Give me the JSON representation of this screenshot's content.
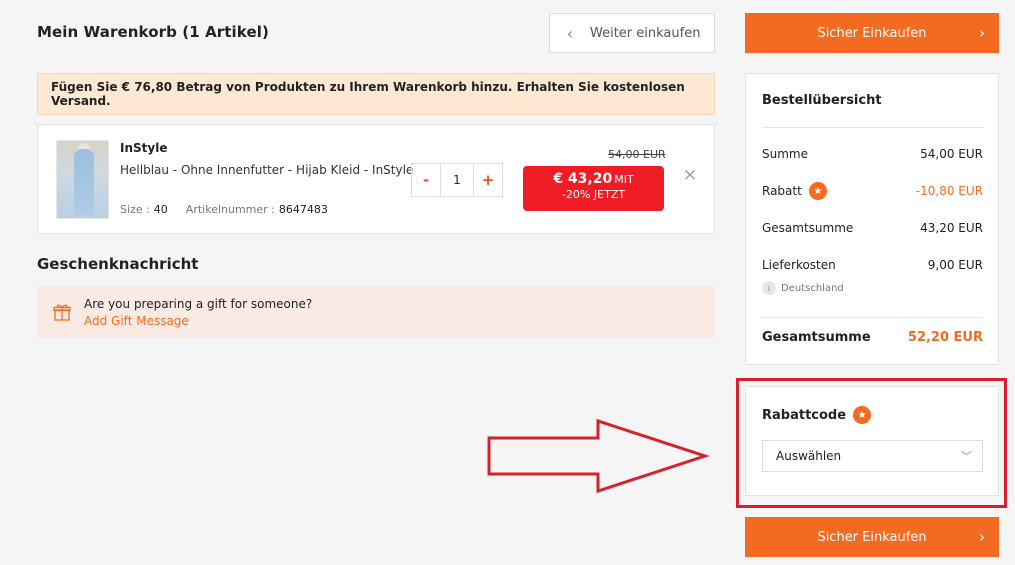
{
  "header": {
    "cart_title": "Mein Warenkorb (1 Artikel)",
    "continue_label": "Weiter einkaufen"
  },
  "shipping_banner": "Fügen Sie € 76,80 Betrag von Produkten zu Ihrem Warenkorb hinzu. Erhalten Sie kostenlosen Versand.",
  "item": {
    "brand": "InStyle",
    "name": "Hellblau - Ohne Innenfutter - Hijab Kleid - InStyle",
    "size_label": "Size :",
    "size_value": "40",
    "article_label": "Artikelnummer :",
    "article_value": "8647483",
    "qty_minus": "-",
    "qty_value": "1",
    "qty_plus": "+",
    "old_price": "54,00 EUR",
    "price": "€ 43,20",
    "price_suffix": "MIT",
    "price_note": "-20% JETZT",
    "remove_icon": "×"
  },
  "gift": {
    "title": "Geschenknachricht",
    "question": "Are you preparing a gift for someone?",
    "action": "Add Gift Message"
  },
  "checkout": {
    "label": "Sicher Einkaufen"
  },
  "summary": {
    "title": "Bestellübersicht",
    "rows": [
      {
        "label": "Summe",
        "value": "54,00 EUR"
      },
      {
        "label": "Rabatt",
        "value": "-10,80 EUR"
      },
      {
        "label": "Gesamtsumme",
        "value": "43,20 EUR"
      },
      {
        "label": "Lieferkosten",
        "value": "9,00 EUR"
      }
    ],
    "country": "Deutschland",
    "grand_label": "Gesamtsumme",
    "grand_value": "52,20 EUR"
  },
  "coupon": {
    "title": "Rabattcode",
    "select_value": "Auswählen"
  },
  "colors": {
    "accent": "#f26b21",
    "price_badge": "#ee1c25",
    "annotation": "#d5212e"
  }
}
